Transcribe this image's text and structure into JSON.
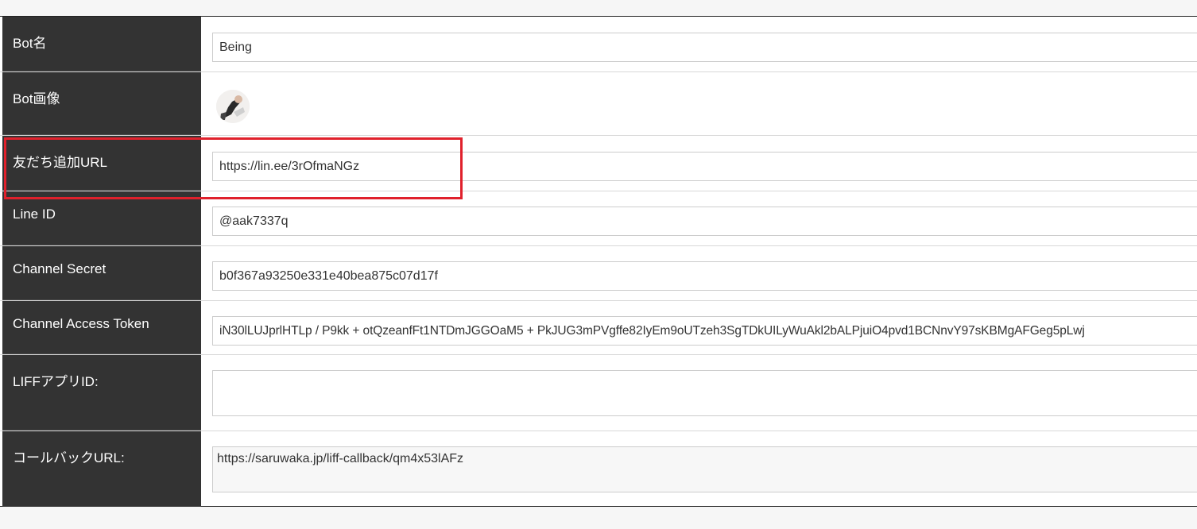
{
  "form": {
    "bot_name": {
      "label": "Bot名",
      "value": "Being"
    },
    "bot_image": {
      "label": "Bot画像"
    },
    "friend_url": {
      "label": "友だち追加URL",
      "value": "https://lin.ee/3rOfmaNGz"
    },
    "line_id": {
      "label": "Line ID",
      "value": "@aak7337q"
    },
    "channel_secret": {
      "label": "Channel Secret",
      "value": "b0f367a93250e331e40bea875c07d17f"
    },
    "channel_access_token": {
      "label": "Channel Access Token",
      "value": "iN30lLUJprlHTLp / P9kk + otQzeanfFt1NTDmJGGOaM5 + PkJUG3mPVgffe82IyEm9oUTzeh3SgTDkUILyWuAkl2bALPjuiO4pvd1BCNnvY97sKBMgAFGeg5pLwj"
    },
    "liff_app_id": {
      "label": "LIFFアプリID:",
      "value": ""
    },
    "callback_url": {
      "label": "コールバックURL:",
      "value": "https://saruwaka.jp/liff-callback/qm4x53lAFz"
    }
  },
  "colors": {
    "label_bg": "#333333",
    "highlight_border": "#e0212c"
  }
}
